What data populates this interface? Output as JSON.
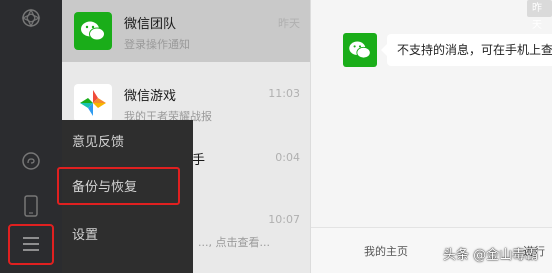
{
  "chats": [
    {
      "name": "微信团队",
      "preview": "登录操作通知",
      "time": "昨天"
    },
    {
      "name": "微信游戏",
      "preview": "我的王者荣耀战报",
      "time": "11:03"
    },
    {
      "name": "手",
      "preview": "",
      "time": "0:04"
    },
    {
      "name": "",
      "preview": "..., 点击查看...",
      "time": "10:07"
    }
  ],
  "menu": {
    "items": [
      "意见反馈",
      "备份与恢复",
      "设置"
    ]
  },
  "conversation": {
    "date_tag": "昨天",
    "message": "不支持的消息，可在手机上查看"
  },
  "bottom_bar": {
    "home": "我的主页",
    "more": "进行"
  },
  "watermark": "头条 @金山毒霸",
  "colors": {
    "sidebar": "#2b2c2f",
    "wechat_green": "#1aad19",
    "highlight_red": "#e02020"
  }
}
